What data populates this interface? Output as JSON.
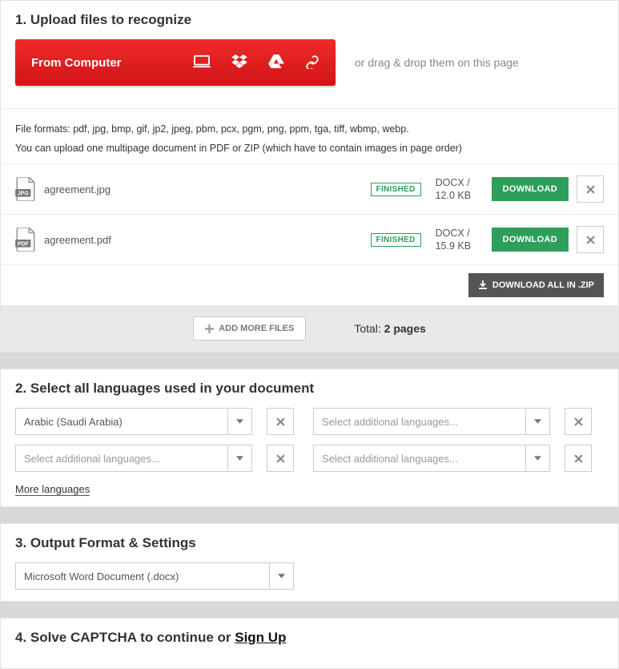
{
  "section1": {
    "title": "1. Upload files to recognize",
    "from_computer": "From Computer",
    "drag_hint": "or drag & drop them on this page",
    "formats_line1": "File formats: pdf, jpg, bmp, gif, jp2, jpeg, pbm, pcx, pgm, png, ppm, tga, tiff, wbmp, webp.",
    "formats_line2": "You can upload one multipage document in PDF or ZIP (which have to contain images in page order)"
  },
  "files": [
    {
      "name": "agreement.jpg",
      "type": "JPG",
      "status": "FINISHED",
      "format": "DOCX /",
      "size": "12.0 KB",
      "download": "DOWNLOAD"
    },
    {
      "name": "agreement.pdf",
      "type": "PDF",
      "status": "FINISHED",
      "format": "DOCX /",
      "size": "15.9 KB",
      "download": "DOWNLOAD"
    }
  ],
  "download_all": "DOWNLOAD ALL IN .ZIP",
  "add_more": "ADD MORE FILES",
  "total_prefix": "Total: ",
  "total_value": "2 pages",
  "section2": {
    "title": "2. Select all languages used in your document",
    "lang1": "Arabic (Saudi Arabia)",
    "placeholder": "Select additional languages...",
    "more": "More languages"
  },
  "section3": {
    "title": "3. Output Format & Settings",
    "output": "Microsoft Word Document (.docx)"
  },
  "section4": {
    "title_prefix": "4. Solve CAPTCHA to continue or ",
    "signup": "Sign Up"
  }
}
